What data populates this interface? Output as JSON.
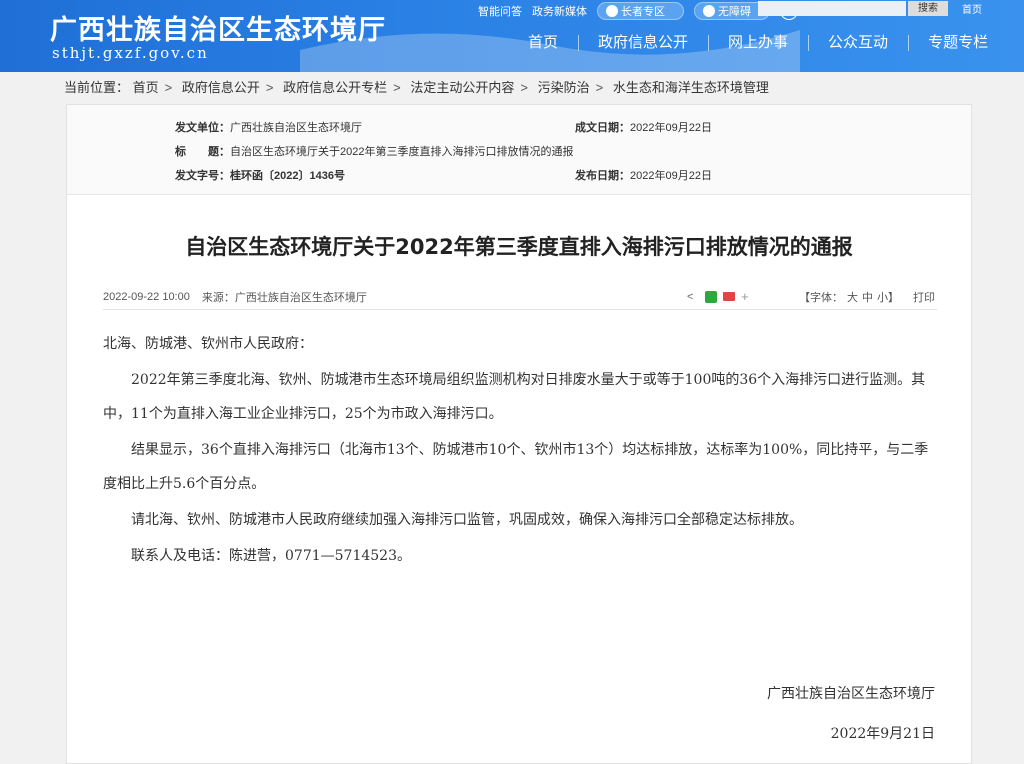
{
  "header": {
    "site_title": "广西壮族自治区生态环境厅",
    "site_domain": "sthjt.gxzf.gov.cn",
    "top_links": [
      "智能问答",
      "政务新媒体"
    ],
    "elder_zone": "长者专区",
    "accessibility": "无障碍",
    "search_button": "搜索",
    "home_link": "首页",
    "nav": [
      "首页",
      "政府信息公开",
      "网上办事",
      "公众互动",
      "专题专栏"
    ]
  },
  "breadcrumb": {
    "prefix": "当前位置：",
    "items": [
      "首页",
      "政府信息公开",
      "政府信息公开专栏",
      "法定主动公开内容",
      "污染防治",
      "水生态和海洋生态环境管理"
    ]
  },
  "meta": {
    "issuer_label": "发文单位：",
    "issuer": "广西壮族自治区生态环境厅",
    "title_label": "标　　题：",
    "title": "自治区生态环境厅关于2022年第三季度直排入海排污口排放情况的通报",
    "doc_no_label": "发文字号：",
    "doc_no": "桂环函〔2022〕1436号",
    "written_label": "成文日期：",
    "written_date": "2022年09月22日",
    "publish_label": "发布日期：",
    "publish_date": "2022年09月22日"
  },
  "article": {
    "title": "自治区生态环境厅关于2022年第三季度直排入海排污口排放情况的通报",
    "datetime": "2022-09-22 10:00",
    "source": "来源：广西壮族自治区生态环境厅",
    "font_label_open": "【字体：",
    "font_large": "大",
    "font_medium": "中",
    "font_small": "小",
    "font_label_close": "】",
    "print": "打印",
    "greeting": "北海、防城港、钦州市人民政府：",
    "p1": "2022年第三季度北海、钦州、防城港市生态环境局组织监测机构对日排废水量大于或等于100吨的36个入海排污口进行监测。其中，11个为直排入海工业企业排污口，25个为市政入海排污口。",
    "p2": "结果显示，36个直排入海排污口（北海市13个、防城港市10个、钦州市13个）均达标排放，达标率为100%，同比持平，与二季度相比上升5.6个百分点。",
    "p3": "请北海、钦州、防城港市人民政府继续加强入海排污口监管，巩固成效，确保入海排污口全部稳定达标排放。",
    "contact": "联系人及电话：陈进营，0771—5714523。",
    "sign_org": "广西壮族自治区生态环境厅",
    "sign_date": "2022年9月21日"
  }
}
